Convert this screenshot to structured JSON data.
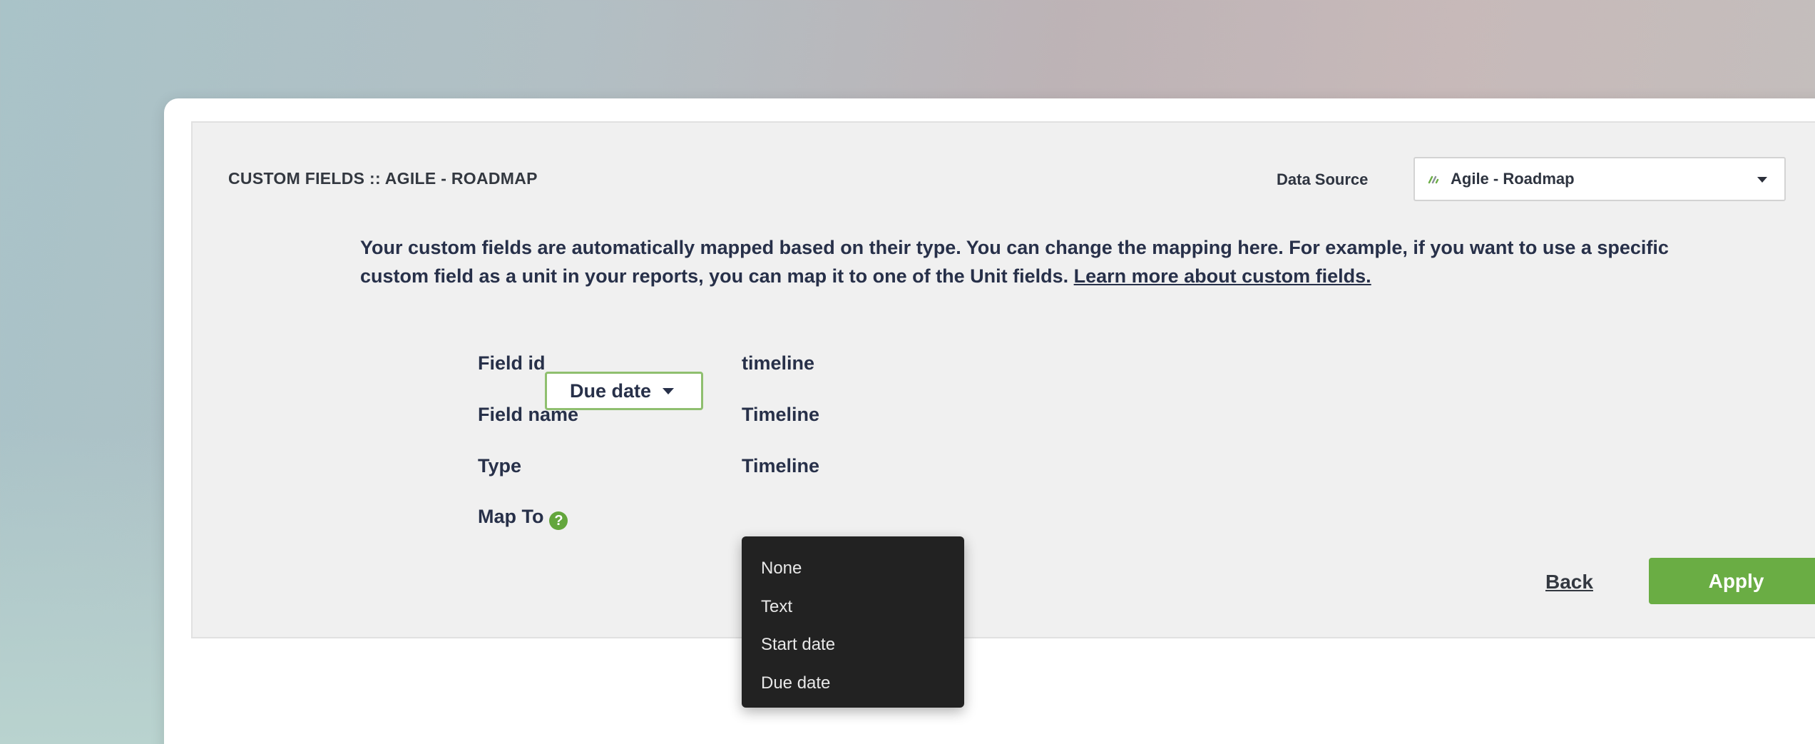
{
  "panel": {
    "title": "CUSTOM FIELDS :: AGILE - ROADMAP",
    "data_source": {
      "label": "Data Source",
      "value": "Agile - Roadmap",
      "logo_icon": "roadmap-logo-icon"
    },
    "description": {
      "text": "Your custom fields are automatically mapped based on their type. You can change the mapping here. For example, if you want to use a specific custom field as a unit in your reports, you can map it to one of the Unit fields. ",
      "link": "Learn more about custom fields."
    },
    "fields": [
      {
        "label": "Field id",
        "value": "timeline"
      },
      {
        "label": "Field name",
        "value": "Timeline"
      },
      {
        "label": "Type",
        "value": "Timeline"
      }
    ],
    "map_to": {
      "label": "Map To",
      "help_icon": "question-circle-icon",
      "selected": "Due date",
      "options": [
        "None",
        "Text",
        "Start date",
        "Due date"
      ]
    },
    "actions": {
      "back": "Back",
      "apply": "Apply"
    }
  },
  "colors": {
    "accent_green": "#6aad44",
    "text_dark": "#273049",
    "dropdown_bg": "#222222"
  }
}
